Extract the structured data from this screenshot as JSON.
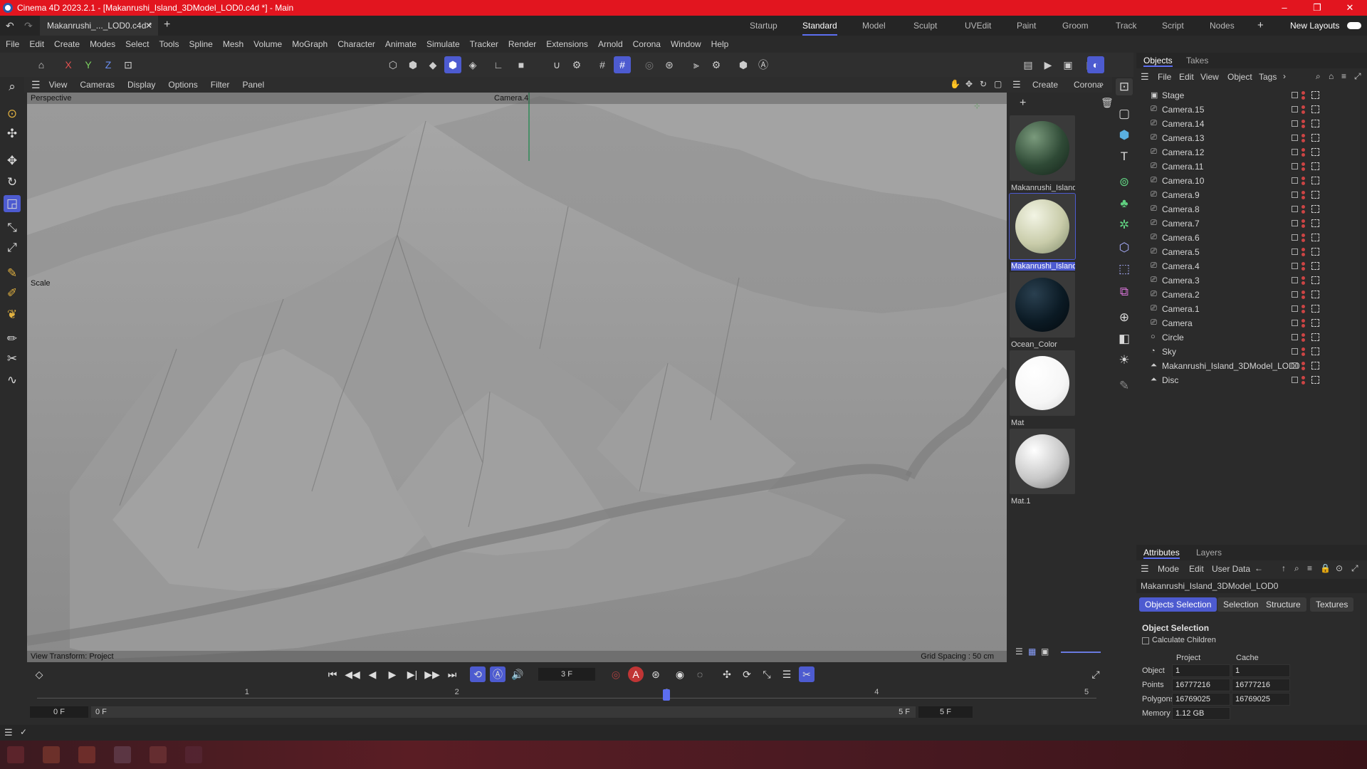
{
  "window": {
    "title": "Cinema 4D 2023.2.1 - [Makanrushi_Island_3DModel_LOD0.c4d *] - Main",
    "controls": {
      "minimize": "–",
      "restore": "❐",
      "close": "✕"
    }
  },
  "tabs": {
    "document": "Makanrushi_..._LOD0.c4d *",
    "close": "✕",
    "add": "+",
    "layouts": [
      "Startup",
      "Standard",
      "Model",
      "Sculpt",
      "UVEdit",
      "Paint",
      "Groom",
      "Track",
      "Script",
      "Nodes"
    ],
    "active_layout": "Standard",
    "new_layouts": "New Layouts"
  },
  "menu": [
    "File",
    "Edit",
    "Create",
    "Modes",
    "Select",
    "Tools",
    "Spline",
    "Mesh",
    "Volume",
    "MoGraph",
    "Character",
    "Animate",
    "Simulate",
    "Tracker",
    "Render",
    "Extensions",
    "Arnold",
    "Corona",
    "Window",
    "Help"
  ],
  "toolbar": {
    "x": "X",
    "y": "Y",
    "z": "Z"
  },
  "viewport": {
    "menu": [
      "View",
      "Cameras",
      "Display",
      "Options",
      "Filter",
      "Panel"
    ],
    "name": "Perspective",
    "camera": "Camera.4",
    "tool_label": "Scale",
    "view_transform": "View Transform: Project",
    "grid_spacing": "Grid Spacing : 50 cm"
  },
  "materials": {
    "menu": [
      "Create",
      "Corona"
    ],
    "items": [
      {
        "label": "Makanrushi_Island",
        "color": "#2f4a36"
      },
      {
        "label": "Makanrushi_Island",
        "color": "#c9ccaa"
      },
      {
        "label": "Ocean_Color",
        "color": "#0b1a24"
      },
      {
        "label": "Mat",
        "color": "#ffffff"
      },
      {
        "label": "Mat.1",
        "color": "#d4d4d4"
      }
    ],
    "selected_index": 1
  },
  "objects_panel": {
    "tabs": [
      "Objects",
      "Takes"
    ],
    "menu": [
      "File",
      "Edit",
      "View",
      "Object",
      "Tags"
    ],
    "items": [
      {
        "name": "Stage",
        "icon": "stage-icon"
      },
      {
        "name": "Camera.15",
        "icon": "camera-icon"
      },
      {
        "name": "Camera.14",
        "icon": "camera-icon"
      },
      {
        "name": "Camera.13",
        "icon": "camera-icon"
      },
      {
        "name": "Camera.12",
        "icon": "camera-icon"
      },
      {
        "name": "Camera.11",
        "icon": "camera-icon"
      },
      {
        "name": "Camera.10",
        "icon": "camera-icon"
      },
      {
        "name": "Camera.9",
        "icon": "camera-icon"
      },
      {
        "name": "Camera.8",
        "icon": "camera-icon"
      },
      {
        "name": "Camera.7",
        "icon": "camera-icon"
      },
      {
        "name": "Camera.6",
        "icon": "camera-icon"
      },
      {
        "name": "Camera.5",
        "icon": "camera-icon"
      },
      {
        "name": "Camera.4",
        "icon": "camera-icon"
      },
      {
        "name": "Camera.3",
        "icon": "camera-icon"
      },
      {
        "name": "Camera.2",
        "icon": "camera-icon"
      },
      {
        "name": "Camera.1",
        "icon": "camera-icon"
      },
      {
        "name": "Camera",
        "icon": "camera-icon"
      },
      {
        "name": "Circle",
        "icon": "circle-icon"
      },
      {
        "name": "Sky",
        "icon": "sky-icon"
      },
      {
        "name": "Makanrushi_Island_3DModel_LOD0",
        "icon": "polygon-object-icon"
      },
      {
        "name": "Disc",
        "icon": "polygon-object-icon"
      }
    ]
  },
  "attributes": {
    "tabs": [
      "Attributes",
      "Layers"
    ],
    "menu": [
      "Mode",
      "Edit",
      "User Data"
    ],
    "object_name": "Makanrushi_Island_3DModel_LOD0",
    "buttons": [
      "Objects Selection",
      "Selection",
      "Structure",
      "Textures"
    ],
    "section": "Object Selection",
    "checkbox_label": "Calculate Children",
    "col_project": "Project",
    "col_cache": "Cache",
    "rows": [
      {
        "label": "Object",
        "project": "1",
        "cache": "1"
      },
      {
        "label": "Points",
        "project": "16777216",
        "cache": "16777216"
      },
      {
        "label": "Polygons",
        "project": "16769025",
        "cache": "16769025"
      },
      {
        "label": "Memory",
        "project": "1.12 GB",
        "cache": ""
      }
    ]
  },
  "timeline": {
    "current_frame": "3 F",
    "start_left": "0 F",
    "start_right": "0 F",
    "end_left": "5 F",
    "end_right": "5 F",
    "ruler": [
      "1",
      "2",
      "3",
      "4",
      "5"
    ],
    "playhead_frame": 3,
    "max_frame": 5
  }
}
